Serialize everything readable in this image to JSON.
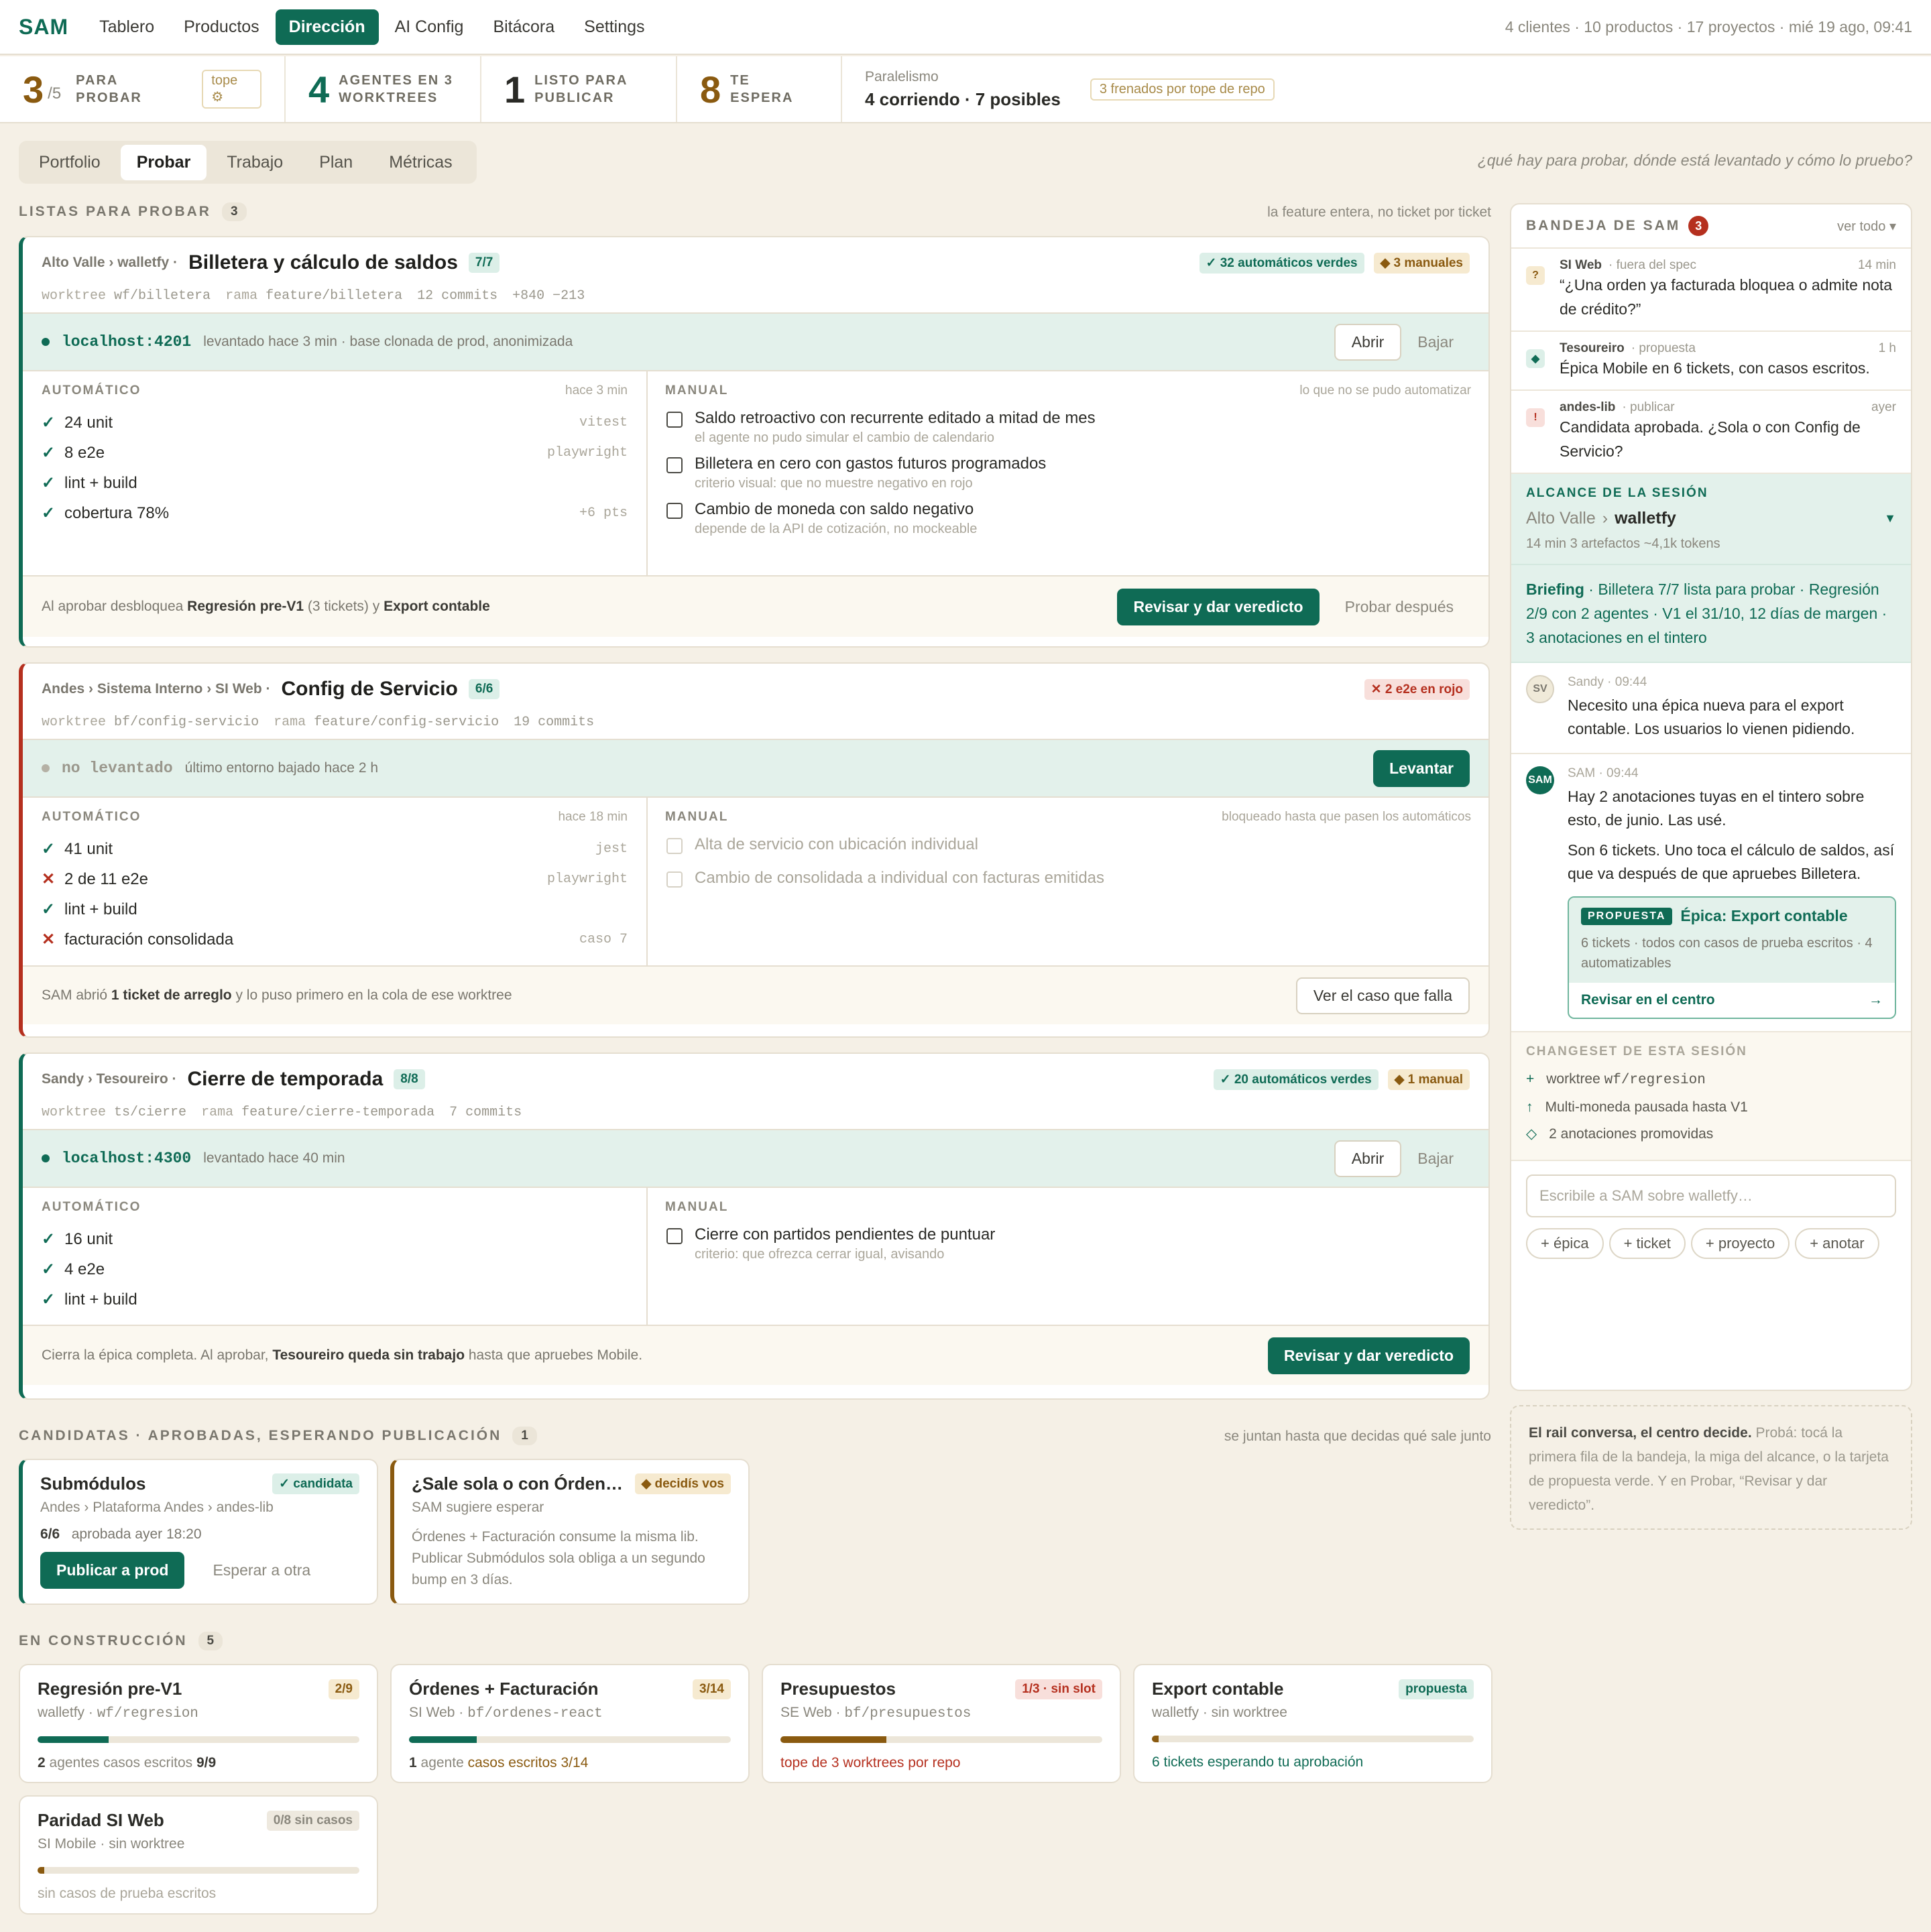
{
  "app": {
    "brand": "SAM",
    "nav": [
      "Tablero",
      "Productos",
      "Dirección",
      "AI Config",
      "Bitácora",
      "Settings"
    ],
    "active_nav": "Dirección",
    "meta": "4 clientes · 10 productos · 17 proyectos · mié 19 ago, 09:41"
  },
  "stats": {
    "probar_num": "3",
    "probar_of": "/5",
    "probar_label": "PARA PROBAR",
    "tope": "tope ⚙",
    "agentes_num": "4",
    "agentes_label1": "AGENTES EN 3",
    "agentes_label2": "WORKTREES",
    "listo_num": "1",
    "listo_label1": "LISTO PARA",
    "listo_label2": "PUBLICAR",
    "espera_num": "8",
    "espera_label": "TE ESPERA",
    "par_title": "Paralelismo",
    "par_value": "4 corriendo · 7 posibles",
    "par_tag": "3 frenados por tope de repo"
  },
  "tabs": {
    "items": [
      "Portfolio",
      "Probar",
      "Trabajo",
      "Plan",
      "Métricas"
    ],
    "active": "Probar",
    "hint": "¿qué hay para probar, dónde está levantado y cómo lo pruebo?"
  },
  "listas": {
    "title": "LISTAS PARA PROBAR",
    "count": "3",
    "hint": "la feature entera, no ticket por ticket"
  },
  "c1": {
    "crumb": "Alto Valle › walletfy ·",
    "title": "Billetera y cálculo de saldos",
    "ratio": "7/7",
    "b1": "✓ 32 automáticos verdes",
    "b2": "◆ 3 manuales",
    "wt_k": "worktree",
    "wt": "wf/billetera",
    "rama_k": "rama",
    "rama": "feature/billetera",
    "commits": "12 commits",
    "diff": "+840 −213",
    "host": "localhost:4201",
    "env": "levantado hace 3 min · base clonada de prod, anonimizada",
    "abrir": "Abrir",
    "bajar": "Bajar",
    "auto_h": "AUTOMÁTICO",
    "auto_t": "hace 3 min",
    "auto": [
      {
        "ic": "✓",
        "t": "24 unit",
        "tool": "vitest"
      },
      {
        "ic": "✓",
        "t": "8 e2e",
        "tool": "playwright"
      },
      {
        "ic": "✓",
        "t": "lint + build",
        "tool": ""
      },
      {
        "ic": "✓",
        "t": "cobertura 78%",
        "tool": "+6 pts"
      }
    ],
    "man_h": "MANUAL",
    "man_t": "lo que no se pudo automatizar",
    "man": [
      {
        "t": "Saldo retroactivo con recurrente editado a mitad de mes",
        "s": "el agente no pudo simular el cambio de calendario"
      },
      {
        "t": "Billetera en cero con gastos futuros programados",
        "s": "criterio visual: que no muestre negativo en rojo"
      },
      {
        "t": "Cambio de moneda con saldo negativo",
        "s": "depende de la API de cotización, no mockeable"
      }
    ],
    "foot_a": "Al aprobar desbloquea ",
    "foot_b": "Regresión pre-V1",
    "foot_c": " (3 tickets) y ",
    "foot_d": "Export contable",
    "cta": "Revisar y dar veredicto",
    "later": "Probar después"
  },
  "c2": {
    "crumb": "Andes › Sistema Interno › SI Web ·",
    "title": "Config de Servicio",
    "ratio": "6/6",
    "b1": "✕ 2 e2e en rojo",
    "wt_k": "worktree",
    "wt": "bf/config-servicio",
    "rama_k": "rama",
    "rama": "feature/config-servicio",
    "commits": "19 commits",
    "host": "no levantado",
    "env": "último entorno bajado hace 2 h",
    "levantar": "Levantar",
    "auto_h": "AUTOMÁTICO",
    "auto_t": "hace 18 min",
    "auto": [
      {
        "ic": "✓",
        "t": "41 unit",
        "tool": "jest"
      },
      {
        "ic": "✕",
        "t": "2 de 11 e2e",
        "tool": "playwright"
      },
      {
        "ic": "✓",
        "t": "lint + build",
        "tool": ""
      },
      {
        "ic": "✕",
        "t": "facturación consolidada",
        "tool": "caso 7"
      }
    ],
    "man_h": "MANUAL",
    "man_t": "bloqueado hasta que pasen los automáticos",
    "man": [
      "Alta de servicio con ubicación individual",
      "Cambio de consolidada a individual con facturas emitidas"
    ],
    "foot_a": "SAM abrió ",
    "foot_b": "1 ticket de arreglo",
    "foot_c": " y lo puso primero en la cola de ese worktree",
    "cta": "Ver el caso que falla"
  },
  "c3": {
    "crumb": "Sandy › Tesoureiro ·",
    "title": "Cierre de temporada",
    "ratio": "8/8",
    "b1": "✓ 20 automáticos verdes",
    "b2": "◆ 1 manual",
    "wt_k": "worktree",
    "wt": "ts/cierre",
    "rama_k": "rama",
    "rama": "feature/cierre-temporada",
    "commits": "7 commits",
    "host": "localhost:4300",
    "env": "levantado hace 40 min",
    "abrir": "Abrir",
    "bajar": "Bajar",
    "auto_h": "AUTOMÁTICO",
    "auto": [
      {
        "ic": "✓",
        "t": "16 unit"
      },
      {
        "ic": "✓",
        "t": "4 e2e"
      },
      {
        "ic": "✓",
        "t": "lint + build"
      }
    ],
    "man_h": "MANUAL",
    "man": [
      {
        "t": "Cierre con partidos pendientes de puntuar",
        "s": "criterio: que ofrezca cerrar igual, avisando"
      }
    ],
    "foot_a": "Cierra la épica completa. Al aprobar, ",
    "foot_b": "Tesoureiro queda sin trabajo",
    "foot_c": " hasta que apruebes Mobile.",
    "cta": "Revisar y dar veredicto"
  },
  "cand": {
    "title": "CANDIDATAS · APROBADAS, ESPERANDO PUBLICACIÓN",
    "count": "1",
    "hint": "se juntan hasta que decidas qué sale junto",
    "a_title": "Submódulos",
    "a_badge": "✓ candidata",
    "a_sub": "Andes › Plataforma Andes › andes-lib",
    "a_ratio": "6/6",
    "a_when": "aprobada ayer 18:20",
    "a_cta": "Publicar a prod",
    "a_alt": "Esperar a otra",
    "b_title": "¿Sale sola o con Órden…",
    "b_badge": "◆ decidís vos",
    "b_sub": "SAM sugiere esperar",
    "b_txt": "Órdenes + Facturación consume la misma lib. Publicar Submódulos sola obliga a un segundo bump en 3 días."
  },
  "constr": {
    "title": "EN CONSTRUCCIÓN",
    "count": "5",
    "items": [
      {
        "t": "Regresión pre-V1",
        "b": "2/9",
        "s1": "walletfy · ",
        "s2": "wf/regresion",
        "f1": "2",
        "f2": " agentes   casos escritos ",
        "f3": "9/9",
        "pct": 0.22
      },
      {
        "t": "Órdenes + Facturación",
        "b": "3/14",
        "s1": "SI Web · ",
        "s2": "bf/ordenes-react",
        "f1": "1",
        "f2": " agente   ",
        "f3": "casos escritos 3/14",
        "pct": 0.21
      },
      {
        "t": "Presupuestos",
        "b": "1/3 · sin slot",
        "s1": "SE Web · ",
        "s2": "bf/presupuestos",
        "f1": "tope de 3 worktrees por repo",
        "pct": 0.33
      },
      {
        "t": "Export contable",
        "b": "propuesta",
        "s1": "walletfy · sin worktree",
        "f1": "6 tickets esperando tu aprobación",
        "pct": 0.02
      },
      {
        "t": "Paridad SI Web",
        "b": "0/8 sin casos",
        "s1": "SI Mobile · sin worktree",
        "f1": "sin casos de prueba escritos",
        "pct": 0.02
      }
    ]
  },
  "rail": {
    "inbox_title": "BANDEJA DE SAM",
    "inbox_count": "3",
    "ver": "ver todo ▾",
    "inbox": [
      {
        "icon": "?",
        "who": "SI Web",
        "tag": "· fuera del spec",
        "t": "14 min",
        "msg": "“¿Una orden ya facturada bloquea o admite nota de crédito?”"
      },
      {
        "icon": "◆",
        "who": "Tesoureiro",
        "tag": "· propuesta",
        "t": "1 h",
        "msg": "Épica Mobile en 6 tickets, con casos escritos."
      },
      {
        "icon": "!",
        "who": "andes-lib",
        "tag": "· publicar",
        "t": "ayer",
        "msg": "Candidata aprobada. ¿Sola o con Config de Servicio?"
      }
    ],
    "scope_h": "ALCANCE DE LA SESIÓN",
    "scope_a": "Alto Valle",
    "scope_b": "walletfy",
    "scope_meta": "14 min   3 artefactos   ~4,1k tokens",
    "brief_b": "Briefing",
    "brief": " · Billetera 7/7 lista para probar · Regresión 2/9 con 2 agentes · V1 el 31/10, 12 días de margen · 3 anotaciones en el tintero",
    "sv_who": "Sandy · 09:44",
    "sv_msg": "Necesito una épica nueva para el export contable. Los usuarios lo vienen pidiendo.",
    "sam_who": "SAM · 09:44",
    "sam_msg1": "Hay 2 anotaciones tuyas en el tintero sobre esto, de junio. Las usé.",
    "sam_msg2": "Son 6 tickets. Uno toca el cálculo de saldos, así que va después de que apruebes Billetera.",
    "prop_tag": "PROPUESTA",
    "prop_title": "Épica: Export contable",
    "prop_sub": "6 tickets · todos con casos de prueba escritos · 4 automatizables",
    "prop_cta": "Revisar en el centro",
    "cs_h": "CHANGESET DE ESTA SESIÓN",
    "cs": [
      {
        "i": "+",
        "a": "worktree ",
        "b": "wf/regresion"
      },
      {
        "i": "↑",
        "a": "Multi-moneda pausada hasta V1",
        "b": ""
      },
      {
        "i": "◇",
        "a": "2 anotaciones promovidas",
        "b": ""
      }
    ],
    "input_ph": "Escribile a SAM sobre walletfy…",
    "pills": [
      "+ épica",
      "+ ticket",
      "+ proyecto",
      "+ anotar"
    ]
  },
  "hint": {
    "b": "El rail conversa, el centro decide.",
    "t": " Probá: tocá la primera fila de la bandeja, la miga del alcance, o la tarjeta de propuesta verde. Y en Probar, “Revisar y dar veredicto”."
  }
}
